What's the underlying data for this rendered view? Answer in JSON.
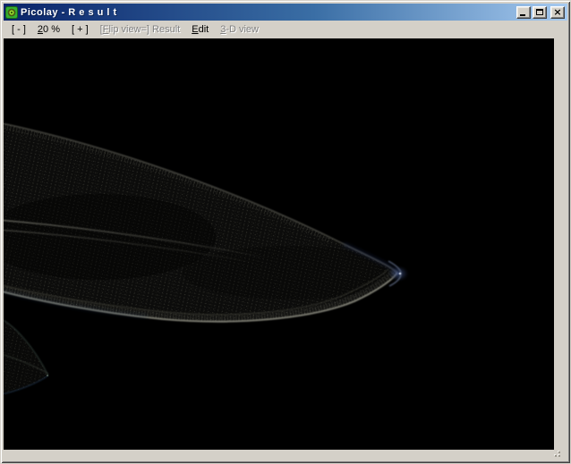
{
  "window": {
    "title": "Picolay - R e s u l t",
    "icon": "picolay-logo",
    "controls": {
      "minimize": "minimize",
      "maximize": "maximize",
      "close": "×"
    }
  },
  "menu": {
    "items": [
      {
        "pre": "[ - ]",
        "accel": "",
        "post": "",
        "enabled": true
      },
      {
        "pre": "",
        "accel": "2",
        "post": "0 %",
        "enabled": true
      },
      {
        "pre": "[ + ]",
        "accel": "",
        "post": "",
        "enabled": true
      },
      {
        "pre": "[",
        "accel": "F",
        "post": "lip view=] Result",
        "enabled": false
      },
      {
        "pre": "",
        "accel": "E",
        "post": "dit",
        "enabled": true
      },
      {
        "pre": "",
        "accel": "3",
        "post": "-D view",
        "enabled": false
      }
    ]
  },
  "canvas": {
    "zoom_level": "20 %",
    "image_alt": "Dark focus-stacked micrograph: large elongated diatom frustule with fine dotted striations tapering to a rounded tip right of center, second faint diatom tip at lower left, black background"
  },
  "colors": {
    "titlebar_gradient_start": "#0a246a",
    "titlebar_gradient_end": "#a6caf0",
    "titlebar_text": "#ffffff",
    "menubar_bg": "#d4d0c8",
    "disabled_text": "#808080",
    "canvas_bg": "#000000",
    "diatom_edge": "#8e8e82",
    "diatom_blue_tint": "#2c3e6e"
  }
}
